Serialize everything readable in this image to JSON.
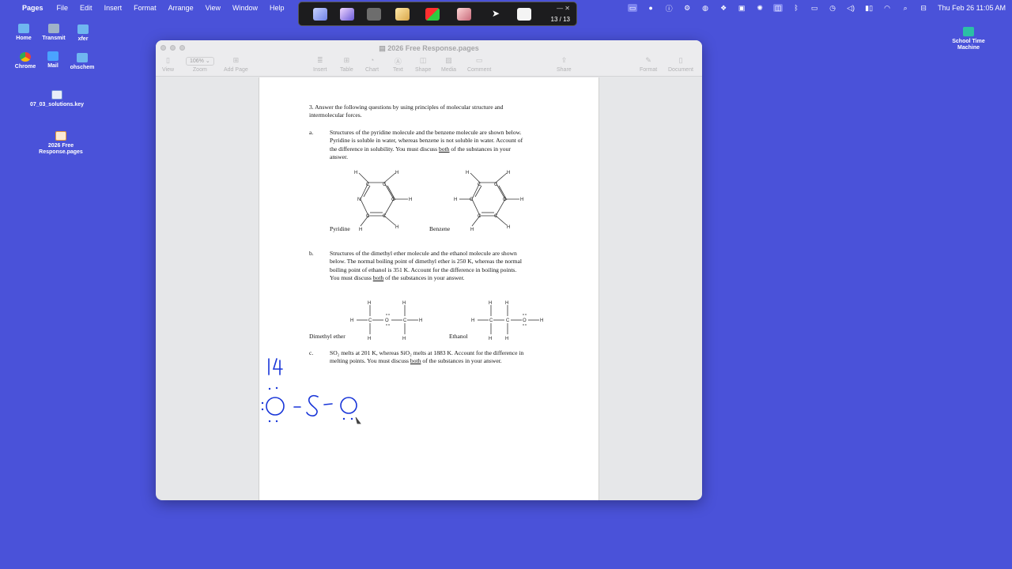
{
  "menubar": {
    "app": "Pages",
    "items": [
      "File",
      "Edit",
      "Insert",
      "Format",
      "Arrange",
      "View",
      "Window",
      "Help"
    ],
    "clock": "Thu Feb 26  11:05 AM"
  },
  "annotation_toolbar": {
    "page_counter": "13 / 13"
  },
  "desktop": {
    "icons": [
      {
        "label": "Home"
      },
      {
        "label": "Transmit"
      },
      {
        "label": "xfer"
      },
      {
        "label": "Chrome"
      },
      {
        "label": "Mail"
      },
      {
        "label": "ohschem"
      },
      {
        "label": "07_03_solutions.key"
      },
      {
        "label": "2026 Free Response.pages"
      },
      {
        "label": "School Time Machine"
      }
    ]
  },
  "window": {
    "title": "2026 Free Response.pages",
    "zoom": "106%",
    "toolbar": {
      "view": "View",
      "zoom": "Zoom",
      "add_page": "Add Page",
      "insert": "Insert",
      "table": "Table",
      "chart": "Chart",
      "text": "Text",
      "shape": "Shape",
      "media": "Media",
      "comment": "Comment",
      "share": "Share",
      "format": "Format",
      "document": "Document"
    }
  },
  "document": {
    "q3_line1": "3. Answer the following questions by using principles of molecular structure and",
    "q3_line2": "intermolecular forces.",
    "a_label": "a.",
    "a_line1": "Structures of the pyridine molecule and the benzene molecule are shown below.",
    "a_line2": "Pyridine is soluble in water, whereas benzene is not soluble in water.  Account of",
    "a_line3_pre": "the difference in solubility.  You must discuss ",
    "a_line3_u": "both",
    "a_line3_post": " of the substances in your",
    "a_line4": "answer.",
    "pyridine": "Pyridine",
    "benzene": "Benzene",
    "b_label": "b.",
    "b_line1": "Structures of the dimethyl ether molecule and the ethanol molecule are shown",
    "b_line2": "below.  The normal boiling point of dimethyl ether is 250 K, whereas the normal",
    "b_line3": "boiling point of ethanol is 351 K.  Account for the difference in boiling points.",
    "b_line4_pre": "You must discuss ",
    "b_line4_u": "both",
    "b_line4_post": " of the substances in your answer.",
    "dimethyl_ether": "Dimethyl ether",
    "ethanol": "Ethanol",
    "c_label": "c.",
    "c_line1": "SO₂ melts at 201 K, whereas SiO₂ melts at 1883 K.  Account for the difference in",
    "c_line2_pre": "melting points.  You must discuss ",
    "c_line2_u": "both",
    "c_line2_post": " of the substances in your answer.",
    "atoms": {
      "H": "H",
      "C": "C",
      "N": "N",
      "O": "O"
    }
  },
  "colors": {
    "desktop": "#4a52d9",
    "ink": "#1835d8"
  }
}
